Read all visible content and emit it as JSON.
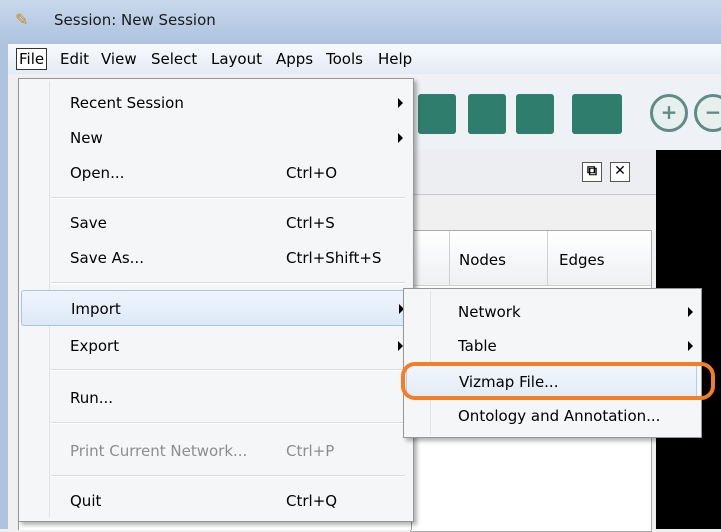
{
  "window": {
    "title": "Session: New Session"
  },
  "menubar": [
    "File",
    "Edit",
    "View",
    "Select",
    "Layout",
    "Apps",
    "Tools",
    "Help"
  ],
  "file_menu": {
    "items": [
      {
        "label": "Recent Session",
        "shortcut": "",
        "has_submenu": true,
        "disabled": false
      },
      {
        "label": "New",
        "shortcut": "",
        "has_submenu": true,
        "disabled": false
      },
      {
        "label": "Open...",
        "shortcut": "Ctrl+O",
        "has_submenu": false,
        "disabled": false
      },
      {
        "label": "Save",
        "shortcut": "Ctrl+S",
        "has_submenu": false,
        "disabled": false
      },
      {
        "label": "Save As...",
        "shortcut": "Ctrl+Shift+S",
        "has_submenu": false,
        "disabled": false
      },
      {
        "label": "Import",
        "shortcut": "",
        "has_submenu": true,
        "disabled": false,
        "highlighted": true
      },
      {
        "label": "Export",
        "shortcut": "",
        "has_submenu": true,
        "disabled": false
      },
      {
        "label": "Run...",
        "shortcut": "",
        "has_submenu": false,
        "disabled": false
      },
      {
        "label": "Print Current Network...",
        "shortcut": "Ctrl+P",
        "has_submenu": false,
        "disabled": true
      },
      {
        "label": "Quit",
        "shortcut": "Ctrl+Q",
        "has_submenu": false,
        "disabled": false
      }
    ]
  },
  "import_submenu": {
    "items": [
      {
        "label": "Network",
        "has_submenu": true
      },
      {
        "label": "Table",
        "has_submenu": true
      },
      {
        "label": "Vizmap File...",
        "has_submenu": false,
        "highlighted": true
      },
      {
        "label": "Ontology and Annotation...",
        "has_submenu": false
      }
    ]
  },
  "network_table": {
    "columns": [
      "Nodes",
      "Edges"
    ]
  },
  "colors": {
    "highlight_ring": "#f57d24",
    "toolbar_icon": "#2f7d6d"
  }
}
